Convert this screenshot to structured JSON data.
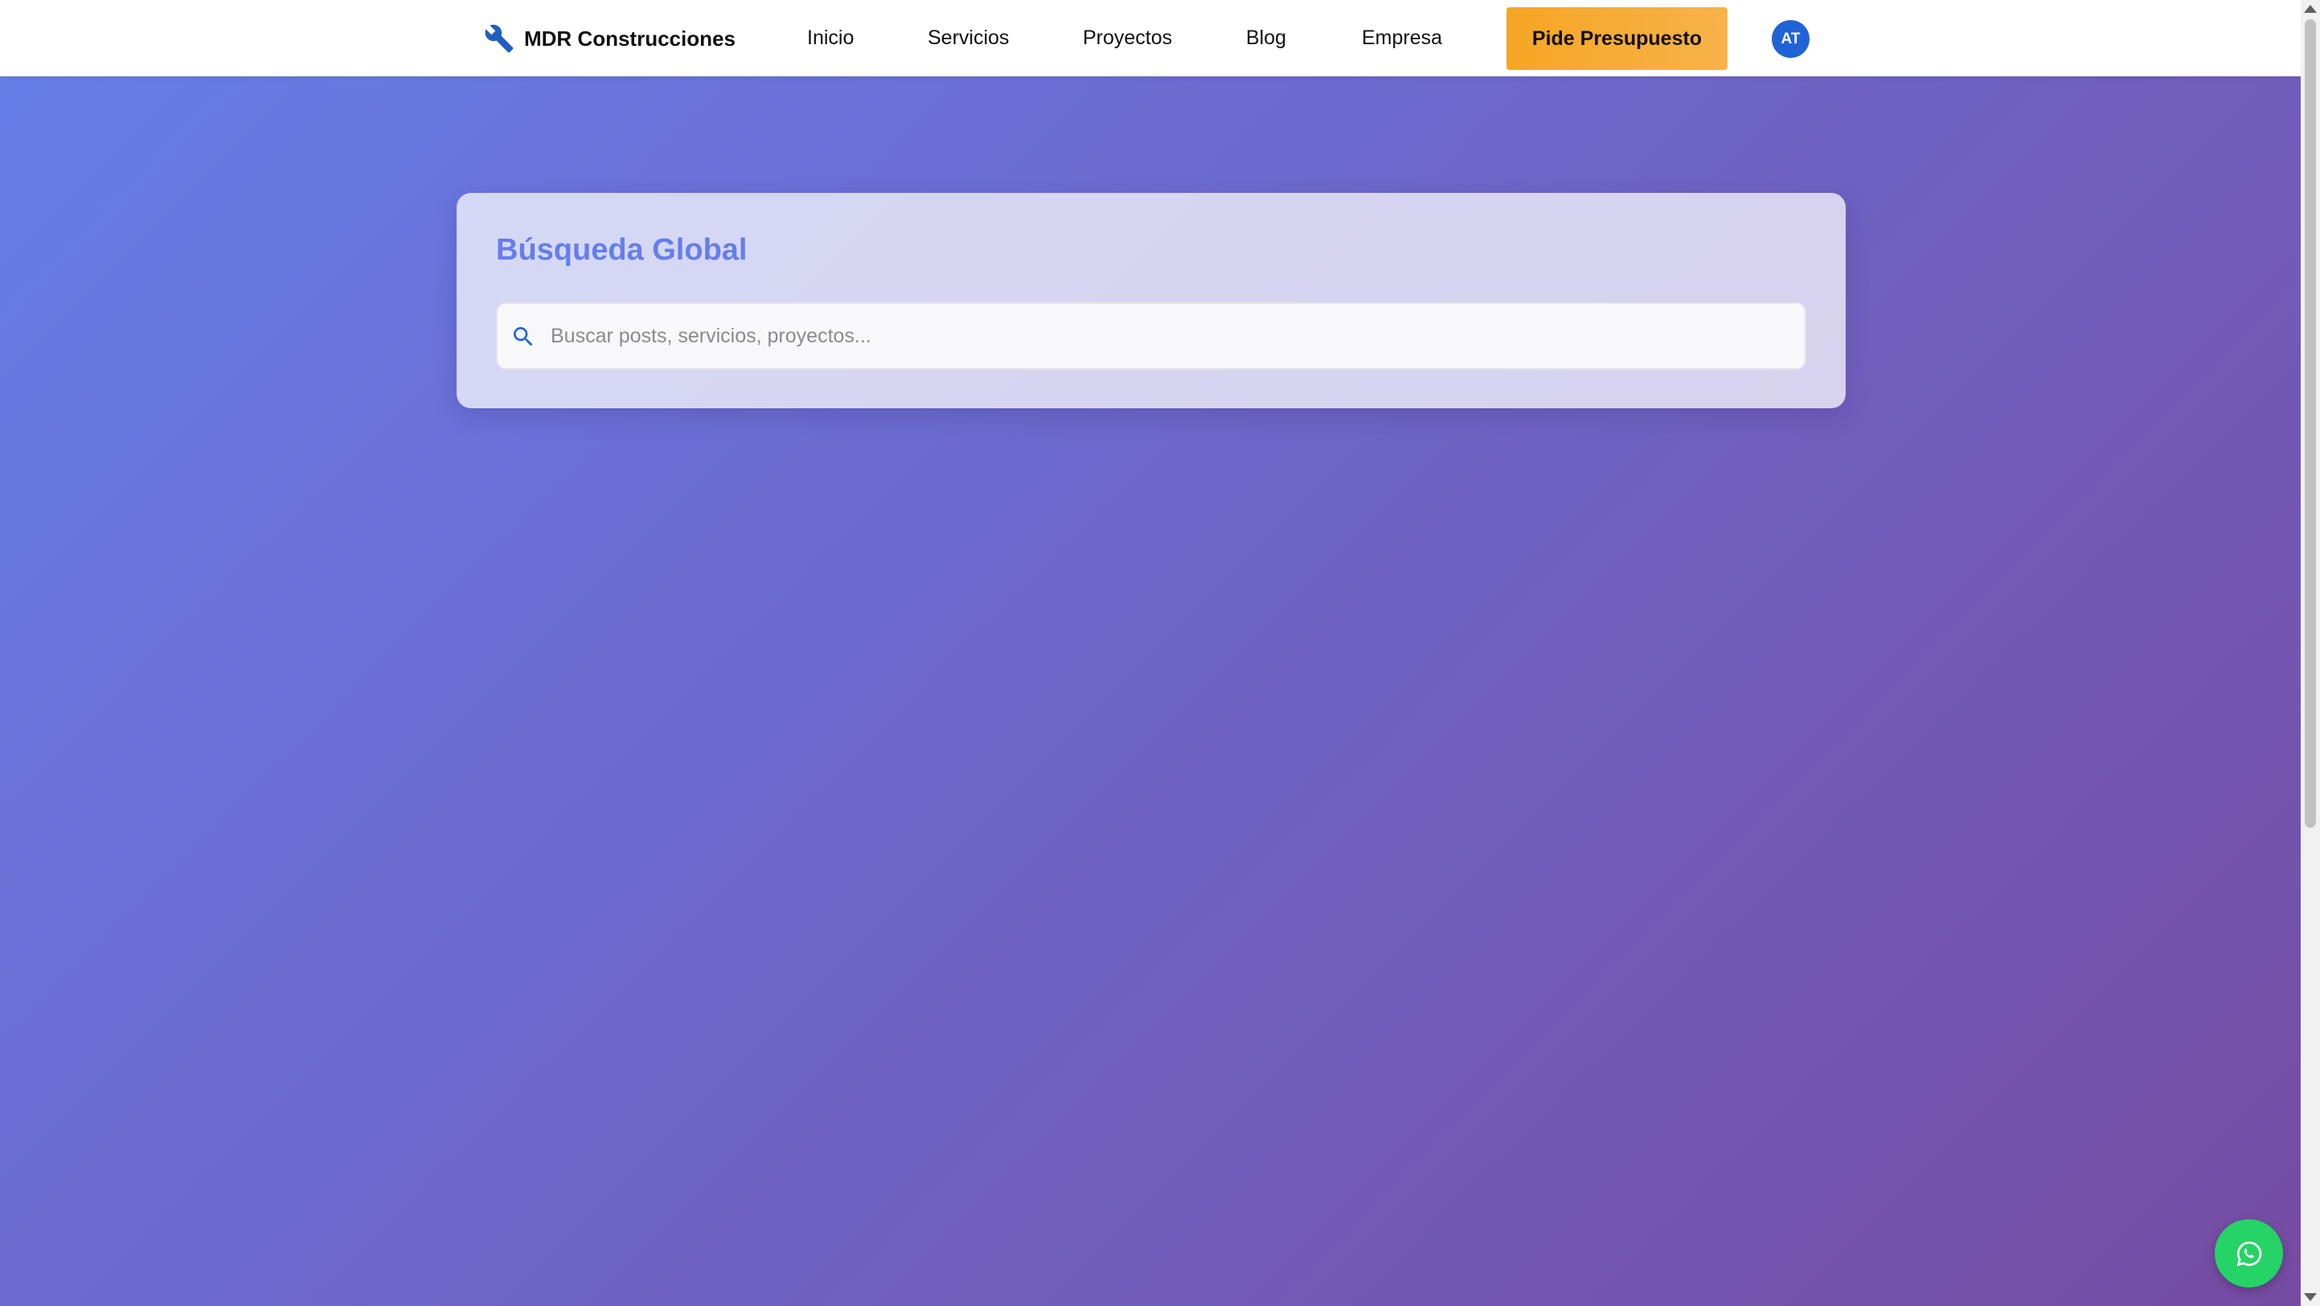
{
  "header": {
    "brand": {
      "name": "MDR Construcciones",
      "icon": "wrench-icon"
    },
    "nav": [
      {
        "label": "Inicio"
      },
      {
        "label": "Servicios"
      },
      {
        "label": "Proyectos"
      },
      {
        "label": "Blog"
      },
      {
        "label": "Empresa"
      }
    ],
    "cta_label": "Pide Presupuesto",
    "avatar_initials": "AT"
  },
  "search": {
    "title": "Búsqueda Global",
    "placeholder": "Buscar posts, servicios, proyectos...",
    "value": "",
    "icon": "search-icon"
  },
  "floating": {
    "icon": "whatsapp-icon"
  },
  "colors": {
    "gradient_start": "#667eea",
    "gradient_end": "#764ba2",
    "cta": "#f5a623",
    "avatar": "#1f63d6",
    "whatsapp": "#25d366",
    "title": "#667eea"
  }
}
